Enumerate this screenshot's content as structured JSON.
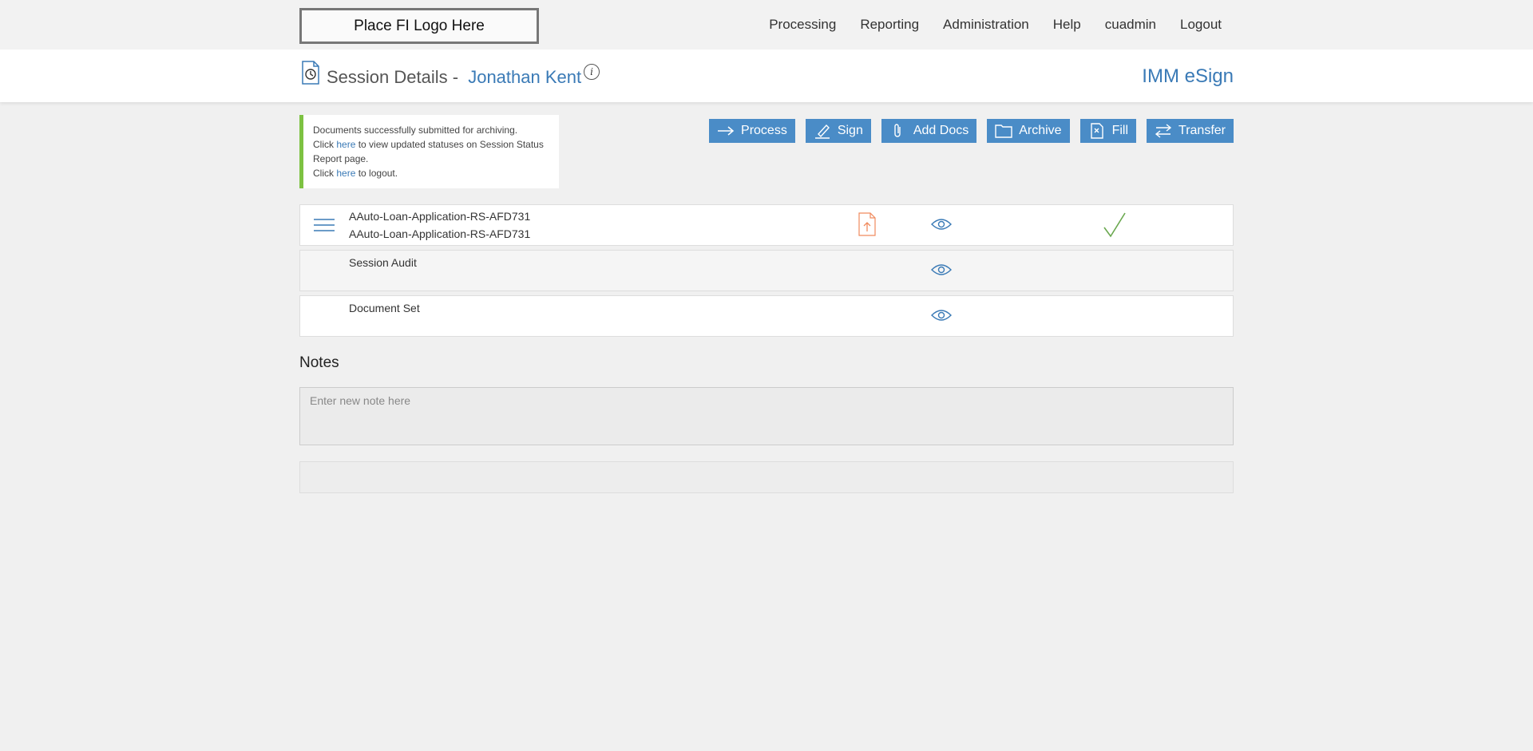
{
  "header": {
    "logo_text": "Place FI Logo Here",
    "nav": [
      "Processing",
      "Reporting",
      "Administration",
      "Help",
      "cuadmin",
      "Logout"
    ]
  },
  "title": {
    "prefix": "Session Details -",
    "name": "Jonathan Kent",
    "info": "i",
    "brand": "IMM eSign"
  },
  "alert": {
    "line1": "Documents successfully submitted for archiving.",
    "line2_pre": "Click ",
    "link": "here",
    "line2_post": " to view updated statuses on Session Status Report page.",
    "line3_pre": "Click ",
    "line3_post": " to logout."
  },
  "actions": [
    "Process",
    "Sign",
    "Add Docs",
    "Archive",
    "Fill",
    "Transfer"
  ],
  "documents": [
    {
      "name": "AAuto-Loan-Application-RS-AFD731",
      "subname": "AAuto-Loan-Application-RS-AFD731"
    },
    {
      "name": "Session Audit"
    },
    {
      "name": "Document Set"
    }
  ],
  "notes": {
    "title": "Notes",
    "placeholder": "Enter new note here"
  },
  "colors": {
    "accent": "#4a8cc7",
    "success": "#7dc242",
    "pdf": "#f08a5d"
  }
}
